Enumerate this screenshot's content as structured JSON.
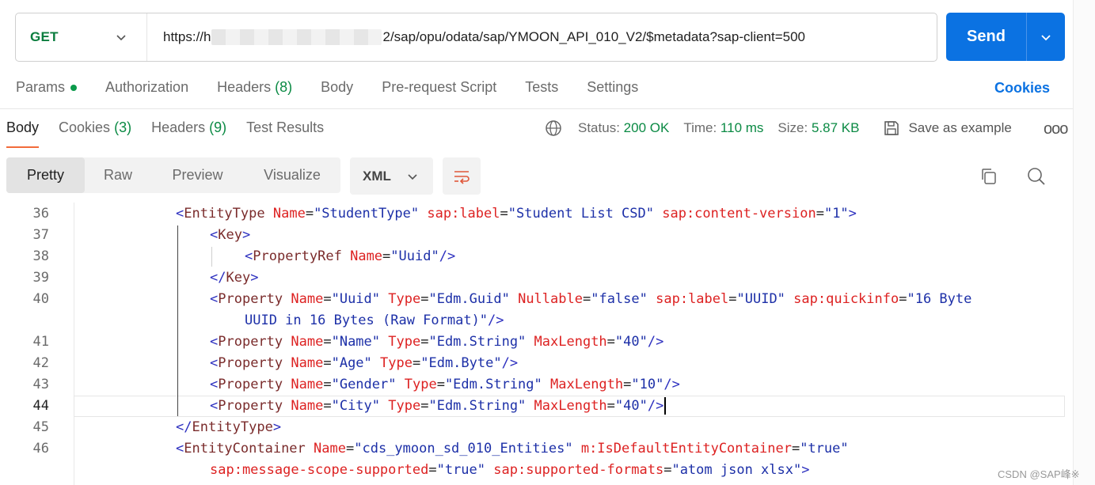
{
  "request": {
    "method": "GET",
    "url_prefix": "https://h",
    "url_suffix": "2/sap/opu/odata/sap/YMOON_API_010_V2/$metadata?sap-client=500",
    "send_label": "Send"
  },
  "request_tabs": {
    "params": "Params",
    "authorization": "Authorization",
    "headers": "Headers",
    "headers_count": "(8)",
    "body": "Body",
    "pre_request": "Pre-request Script",
    "tests": "Tests",
    "settings": "Settings",
    "cookies": "Cookies"
  },
  "response_tabs": {
    "body": "Body",
    "cookies": "Cookies",
    "cookies_count": "(3)",
    "headers": "Headers",
    "headers_count": "(9)",
    "test_results": "Test Results"
  },
  "response_status": {
    "status_label": "Status:",
    "status_value": "200 OK",
    "time_label": "Time:",
    "time_value": "110 ms",
    "size_label": "Size:",
    "size_value": "5.87 KB",
    "save_example": "Save as example",
    "more": "ooo"
  },
  "format_toolbar": {
    "pretty": "Pretty",
    "raw": "Raw",
    "preview": "Preview",
    "visualize": "Visualize",
    "language": "XML"
  },
  "code": {
    "lines": [
      {
        "num": "36",
        "tokens": [
          [
            "t-br",
            "<"
          ],
          [
            "t-tag",
            "EntityType"
          ],
          [
            "t-eq",
            " "
          ],
          [
            "t-attr",
            "Name"
          ],
          [
            "t-eq",
            "="
          ],
          [
            "t-val",
            "\"StudentType\""
          ],
          [
            "t-eq",
            " "
          ],
          [
            "t-attr",
            "sap:label"
          ],
          [
            "t-eq",
            "="
          ],
          [
            "t-val",
            "\"Student List CSD\""
          ],
          [
            "t-eq",
            " "
          ],
          [
            "t-attr",
            "sap:content-version"
          ],
          [
            "t-eq",
            "="
          ],
          [
            "t-val",
            "\"1\""
          ],
          [
            "t-br",
            ">"
          ]
        ]
      },
      {
        "num": "37",
        "tokens": [
          [
            "t-br",
            "<"
          ],
          [
            "t-tag",
            "Key"
          ],
          [
            "t-br",
            ">"
          ]
        ]
      },
      {
        "num": "38",
        "tokens": [
          [
            "t-br",
            "<"
          ],
          [
            "t-tag",
            "PropertyRef"
          ],
          [
            "t-eq",
            " "
          ],
          [
            "t-attr",
            "Name"
          ],
          [
            "t-eq",
            "="
          ],
          [
            "t-val",
            "\"Uuid\""
          ],
          [
            "t-br",
            "/>"
          ]
        ]
      },
      {
        "num": "39",
        "tokens": [
          [
            "t-br",
            "</"
          ],
          [
            "t-tag",
            "Key"
          ],
          [
            "t-br",
            ">"
          ]
        ]
      },
      {
        "num": "40",
        "tokens": [
          [
            "t-br",
            "<"
          ],
          [
            "t-tag",
            "Property"
          ],
          [
            "t-eq",
            " "
          ],
          [
            "t-attr",
            "Name"
          ],
          [
            "t-eq",
            "="
          ],
          [
            "t-val",
            "\"Uuid\""
          ],
          [
            "t-eq",
            " "
          ],
          [
            "t-attr",
            "Type"
          ],
          [
            "t-eq",
            "="
          ],
          [
            "t-val",
            "\"Edm.Guid\""
          ],
          [
            "t-eq",
            " "
          ],
          [
            "t-attr",
            "Nullable"
          ],
          [
            "t-eq",
            "="
          ],
          [
            "t-val",
            "\"false\""
          ],
          [
            "t-eq",
            " "
          ],
          [
            "t-attr",
            "sap:label"
          ],
          [
            "t-eq",
            "="
          ],
          [
            "t-val",
            "\"UUID\""
          ],
          [
            "t-eq",
            " "
          ],
          [
            "t-attr",
            "sap:quickinfo"
          ],
          [
            "t-eq",
            "="
          ],
          [
            "t-val",
            "\"16 Byte"
          ]
        ]
      },
      {
        "num": "",
        "tokens": [
          [
            "t-val",
            "UUID in 16 Bytes (Raw Format)\""
          ],
          [
            "t-br",
            "/>"
          ]
        ]
      },
      {
        "num": "41",
        "tokens": [
          [
            "t-br",
            "<"
          ],
          [
            "t-tag",
            "Property"
          ],
          [
            "t-eq",
            " "
          ],
          [
            "t-attr",
            "Name"
          ],
          [
            "t-eq",
            "="
          ],
          [
            "t-val",
            "\"Name\""
          ],
          [
            "t-eq",
            " "
          ],
          [
            "t-attr",
            "Type"
          ],
          [
            "t-eq",
            "="
          ],
          [
            "t-val",
            "\"Edm.String\""
          ],
          [
            "t-eq",
            " "
          ],
          [
            "t-attr",
            "MaxLength"
          ],
          [
            "t-eq",
            "="
          ],
          [
            "t-val",
            "\"40\""
          ],
          [
            "t-br",
            "/>"
          ]
        ]
      },
      {
        "num": "42",
        "tokens": [
          [
            "t-br",
            "<"
          ],
          [
            "t-tag",
            "Property"
          ],
          [
            "t-eq",
            " "
          ],
          [
            "t-attr",
            "Name"
          ],
          [
            "t-eq",
            "="
          ],
          [
            "t-val",
            "\"Age\""
          ],
          [
            "t-eq",
            " "
          ],
          [
            "t-attr",
            "Type"
          ],
          [
            "t-eq",
            "="
          ],
          [
            "t-val",
            "\"Edm.Byte\""
          ],
          [
            "t-br",
            "/>"
          ]
        ]
      },
      {
        "num": "43",
        "tokens": [
          [
            "t-br",
            "<"
          ],
          [
            "t-tag",
            "Property"
          ],
          [
            "t-eq",
            " "
          ],
          [
            "t-attr",
            "Name"
          ],
          [
            "t-eq",
            "="
          ],
          [
            "t-val",
            "\"Gender\""
          ],
          [
            "t-eq",
            " "
          ],
          [
            "t-attr",
            "Type"
          ],
          [
            "t-eq",
            "="
          ],
          [
            "t-val",
            "\"Edm.String\""
          ],
          [
            "t-eq",
            " "
          ],
          [
            "t-attr",
            "MaxLength"
          ],
          [
            "t-eq",
            "="
          ],
          [
            "t-val",
            "\"10\""
          ],
          [
            "t-br",
            "/>"
          ]
        ]
      },
      {
        "num": "44",
        "tokens": [
          [
            "t-br",
            "<"
          ],
          [
            "t-tag",
            "Property"
          ],
          [
            "t-eq",
            " "
          ],
          [
            "t-attr",
            "Name"
          ],
          [
            "t-eq",
            "="
          ],
          [
            "t-val",
            "\"City\""
          ],
          [
            "t-eq",
            " "
          ],
          [
            "t-attr",
            "Type"
          ],
          [
            "t-eq",
            "="
          ],
          [
            "t-val",
            "\"Edm.String\""
          ],
          [
            "t-eq",
            " "
          ],
          [
            "t-attr",
            "MaxLength"
          ],
          [
            "t-eq",
            "="
          ],
          [
            "t-val",
            "\"40\""
          ],
          [
            "t-br",
            "/>"
          ]
        ]
      },
      {
        "num": "45",
        "tokens": [
          [
            "t-br",
            "</"
          ],
          [
            "t-tag",
            "EntityType"
          ],
          [
            "t-br",
            ">"
          ]
        ]
      },
      {
        "num": "46",
        "tokens": [
          [
            "t-br",
            "<"
          ],
          [
            "t-tag",
            "EntityContainer"
          ],
          [
            "t-eq",
            " "
          ],
          [
            "t-attr",
            "Name"
          ],
          [
            "t-eq",
            "="
          ],
          [
            "t-val",
            "\"cds_ymoon_sd_010_Entities\""
          ],
          [
            "t-eq",
            " "
          ],
          [
            "t-attr",
            "m:IsDefaultEntityContainer"
          ],
          [
            "t-eq",
            "="
          ],
          [
            "t-val",
            "\"true\""
          ]
        ]
      },
      {
        "num": "",
        "tokens": [
          [
            "t-attr",
            "sap:message-scope-supported"
          ],
          [
            "t-eq",
            "="
          ],
          [
            "t-val",
            "\"true\""
          ],
          [
            "t-eq",
            " "
          ],
          [
            "t-attr",
            "sap:supported-formats"
          ],
          [
            "t-eq",
            "="
          ],
          [
            "t-val",
            "\"atom json xlsx\""
          ],
          [
            "t-br",
            ">"
          ]
        ]
      }
    ]
  },
  "watermark": "CSDN @SAP峰※"
}
